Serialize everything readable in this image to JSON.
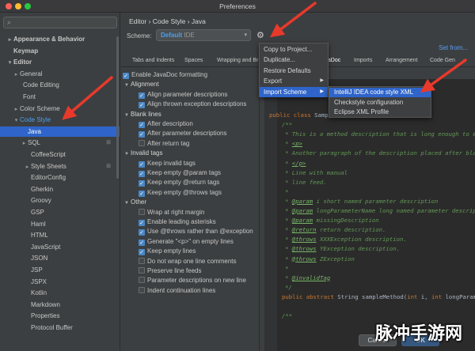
{
  "window": {
    "title": "Preferences"
  },
  "sidebar": {
    "items": [
      {
        "label": "Appearance & Behavior",
        "arrow": "▸",
        "bold": true
      },
      {
        "label": "Keymap",
        "arrow": "",
        "bold": true
      },
      {
        "label": "Editor",
        "arrow": "▾",
        "bold": true
      },
      {
        "label": "General",
        "arrow": "▸"
      },
      {
        "label": "Code Editing",
        "arrow": ""
      },
      {
        "label": "Font",
        "arrow": ""
      },
      {
        "label": "Color Scheme",
        "arrow": "▸"
      },
      {
        "label": "Code Style",
        "arrow": "▾",
        "accent": true
      },
      {
        "label": "Java",
        "arrow": "",
        "selected": true
      },
      {
        "label": "SQL",
        "arrow": "▸",
        "mark": "⊞"
      },
      {
        "label": "CoffeeScript",
        "arrow": ""
      },
      {
        "label": "Style Sheets",
        "arrow": "▸",
        "mark": "⊞"
      },
      {
        "label": "EditorConfig",
        "arrow": ""
      },
      {
        "label": "Gherkin",
        "arrow": ""
      },
      {
        "label": "Groovy",
        "arrow": ""
      },
      {
        "label": "GSP",
        "arrow": ""
      },
      {
        "label": "Haml",
        "arrow": ""
      },
      {
        "label": "HTML",
        "arrow": ""
      },
      {
        "label": "JavaScript",
        "arrow": ""
      },
      {
        "label": "JSON",
        "arrow": ""
      },
      {
        "label": "JSP",
        "arrow": ""
      },
      {
        "label": "JSPX",
        "arrow": ""
      },
      {
        "label": "Kotlin",
        "arrow": ""
      },
      {
        "label": "Markdown",
        "arrow": ""
      },
      {
        "label": "Properties",
        "arrow": ""
      },
      {
        "label": "Protocol Buffer",
        "arrow": ""
      }
    ]
  },
  "main": {
    "breadcrumb": "Editor  ›  Code Style  ›  Java",
    "scheme_label": "Scheme:",
    "scheme_value": "Default",
    "scheme_sub": "IDE",
    "set_from": "Set from...",
    "tabs": [
      "Tabs and Indents",
      "Spaces",
      "Wrapping and Br",
      "JavaDoc",
      "Imports",
      "Arrangement",
      "Code Gen"
    ],
    "options": [
      {
        "type": "cb",
        "on": true,
        "label": "Enable JavaDoc formatting",
        "indent": 0
      },
      {
        "type": "hdr",
        "label": "Alignment"
      },
      {
        "type": "cb",
        "on": true,
        "label": "Align parameter descriptions",
        "indent": 1
      },
      {
        "type": "cb",
        "on": true,
        "label": "Align thrown exception descriptions",
        "indent": 1
      },
      {
        "type": "hdr",
        "label": "Blank lines"
      },
      {
        "type": "cb",
        "on": true,
        "label": "After description",
        "indent": 1
      },
      {
        "type": "cb",
        "on": true,
        "label": "After parameter descriptions",
        "indent": 1
      },
      {
        "type": "cb",
        "on": false,
        "label": "After return tag",
        "indent": 1
      },
      {
        "type": "hdr",
        "label": "Invalid tags"
      },
      {
        "type": "cb",
        "on": true,
        "label": "Keep invalid tags",
        "indent": 1
      },
      {
        "type": "cb",
        "on": true,
        "label": "Keep empty @param tags",
        "indent": 1
      },
      {
        "type": "cb",
        "on": true,
        "label": "Keep empty @return tags",
        "indent": 1
      },
      {
        "type": "cb",
        "on": true,
        "label": "Keep empty @throws tags",
        "indent": 1
      },
      {
        "type": "hdr",
        "label": "Other"
      },
      {
        "type": "cb",
        "on": false,
        "label": "Wrap at right margin",
        "indent": 1
      },
      {
        "type": "cb",
        "on": true,
        "label": "Enable leading asterisks",
        "indent": 1
      },
      {
        "type": "cb",
        "on": true,
        "label": "Use @throws rather than @exception",
        "indent": 1
      },
      {
        "type": "cb",
        "on": true,
        "label": "Generate \"<p>\" on empty lines",
        "indent": 1
      },
      {
        "type": "cb",
        "on": true,
        "label": "Keep empty lines",
        "indent": 1
      },
      {
        "type": "cb",
        "on": false,
        "label": "Do not wrap one line comments",
        "indent": 1
      },
      {
        "type": "cb",
        "on": false,
        "label": "Preserve line feeds",
        "indent": 1
      },
      {
        "type": "cb",
        "on": false,
        "label": "Parameter descriptions on new line",
        "indent": 1
      },
      {
        "type": "cb",
        "on": false,
        "label": "Indent continuation lines",
        "indent": 1
      }
    ]
  },
  "menu": {
    "items": [
      {
        "label": "Copy to Project..."
      },
      {
        "label": "Duplicate..."
      },
      {
        "label": "Restore Defaults"
      },
      {
        "label": "Export",
        "submenu": true
      },
      {
        "label": "Import Scheme",
        "submenu": true,
        "highlighted": true
      }
    ],
    "submenu": [
      {
        "label": "IntelliJ IDEA code style XML",
        "highlighted": true
      },
      {
        "label": "Checkstyle configuration"
      },
      {
        "label": "Eclipse XML Profile"
      }
    ]
  },
  "code": [
    {
      "x": 4,
      "parts": [
        {
          "c": "kw",
          "t": "public "
        },
        {
          "c": "kw",
          "t": "class "
        },
        {
          "c": "pl",
          "t": "Sample {"
        }
      ]
    },
    {
      "x": 20,
      "parts": [
        {
          "c": "doc",
          "t": "/**"
        }
      ]
    },
    {
      "x": 24,
      "parts": [
        {
          "c": "doc",
          "t": "* This is a method description that is long enough to exceed right margin."
        }
      ]
    },
    {
      "x": 24,
      "parts": [
        {
          "c": "doc",
          "t": "* "
        },
        {
          "c": "tag",
          "t": "<p>"
        }
      ]
    },
    {
      "x": 24,
      "parts": [
        {
          "c": "doc",
          "t": "* Another paragraph of the description placed after blank line."
        }
      ]
    },
    {
      "x": 24,
      "parts": [
        {
          "c": "doc",
          "t": "* "
        },
        {
          "c": "tag",
          "t": "</p>"
        }
      ]
    },
    {
      "x": 24,
      "parts": [
        {
          "c": "doc",
          "t": "* Line with manual"
        }
      ]
    },
    {
      "x": 24,
      "parts": [
        {
          "c": "doc",
          "t": "* line feed."
        }
      ]
    },
    {
      "x": 24,
      "parts": [
        {
          "c": "doc",
          "t": "*"
        }
      ]
    },
    {
      "x": 24,
      "parts": [
        {
          "c": "doc",
          "t": "* "
        },
        {
          "c": "tag",
          "t": "@param"
        },
        {
          "c": "doc",
          "t": " i              short named parameter description"
        }
      ]
    },
    {
      "x": 24,
      "parts": [
        {
          "c": "doc",
          "t": "* "
        },
        {
          "c": "tag",
          "t": "@param"
        },
        {
          "c": "doc",
          "t": " longParameterName  long named parameter description"
        }
      ]
    },
    {
      "x": 24,
      "parts": [
        {
          "c": "doc",
          "t": "* "
        },
        {
          "c": "tag",
          "t": "@param"
        },
        {
          "c": "doc",
          "t": " missingDescription"
        }
      ]
    },
    {
      "x": 24,
      "parts": [
        {
          "c": "doc",
          "t": "* "
        },
        {
          "c": "tag",
          "t": "@return"
        },
        {
          "c": "doc",
          "t": " return description."
        }
      ]
    },
    {
      "x": 24,
      "parts": [
        {
          "c": "doc",
          "t": "* "
        },
        {
          "c": "tag",
          "t": "@throws"
        },
        {
          "c": "doc",
          "t": " XXXException description."
        }
      ]
    },
    {
      "x": 24,
      "parts": [
        {
          "c": "doc",
          "t": "* "
        },
        {
          "c": "tag",
          "t": "@throws"
        },
        {
          "c": "doc",
          "t": " YException   description."
        }
      ]
    },
    {
      "x": 24,
      "parts": [
        {
          "c": "doc",
          "t": "* "
        },
        {
          "c": "tag",
          "t": "@throws"
        },
        {
          "c": "doc",
          "t": " ZException"
        }
      ]
    },
    {
      "x": 24,
      "parts": [
        {
          "c": "doc",
          "t": "*"
        }
      ]
    },
    {
      "x": 24,
      "parts": [
        {
          "c": "doc",
          "t": "* "
        },
        {
          "c": "tag",
          "t": "@invalidTag"
        }
      ]
    },
    {
      "x": 24,
      "parts": [
        {
          "c": "doc",
          "t": "*/"
        }
      ]
    },
    {
      "x": 20,
      "parts": [
        {
          "c": "kw",
          "t": "public abstract "
        },
        {
          "c": "pl",
          "t": "String sampleMethod("
        },
        {
          "c": "kw",
          "t": "int "
        },
        {
          "c": "pl",
          "t": "i, "
        },
        {
          "c": "kw",
          "t": "int "
        },
        {
          "c": "pl",
          "t": "longParameterName)"
        }
      ]
    },
    {
      "x": 20,
      "parts": [
        {
          "c": "pl",
          "t": ""
        }
      ]
    },
    {
      "x": 20,
      "parts": [
        {
          "c": "doc",
          "t": "/**"
        }
      ]
    }
  ],
  "buttons": {
    "cancel": "Cancel",
    "ok": "OK"
  },
  "watermark": "脉冲手游网",
  "colors": {
    "accent": "#2f65ca",
    "arrow": "#e8392b",
    "link": "#589df6"
  }
}
